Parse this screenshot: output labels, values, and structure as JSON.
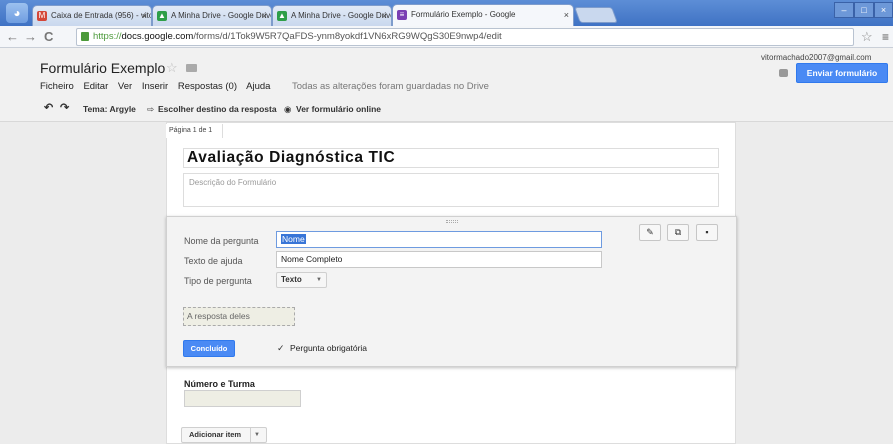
{
  "browser": {
    "tabs": [
      {
        "label": "Caixa de Entrada (956) - vito",
        "icon": "gmail-icon",
        "icon_color": "#d44638"
      },
      {
        "label": "A Minha Drive - Google Drive",
        "icon": "drive-icon",
        "icon_color": "#2e9e48"
      },
      {
        "label": "A Minha Drive - Google Drive",
        "icon": "drive-icon",
        "icon_color": "#2e9e48"
      },
      {
        "label": "Formulário Exemplo - Google",
        "icon": "forms-icon",
        "icon_color": "#7a3fb3"
      }
    ],
    "url_scheme": "https://",
    "url_host": "docs.google.com",
    "url_path": "/forms/d/1Tok9W5R7QaFDS-ynm8yokdf1VN6xRG9WQgS30E9nwp4/edit"
  },
  "header": {
    "doc_title": "Formulário Exemplo",
    "menu": [
      "Ficheiro",
      "Editar",
      "Ver",
      "Inserir",
      "Respostas (0)",
      "Ajuda"
    ],
    "saved_status": "Todas as alterações foram guardadas no Drive",
    "user_email": "vitormachado2007@gmail.com",
    "send_label": "Enviar formulário"
  },
  "toolbar": {
    "theme": "Tema: Argyle",
    "destination": "Escolher destino da resposta",
    "view_online": "Ver formulário online"
  },
  "form": {
    "page_indicator": "Página 1 de 1",
    "title": "Avaliação Diagnóstica TIC",
    "description_placeholder": "Descrição do Formulário"
  },
  "question_editor": {
    "name_label": "Nome da pergunta",
    "name_value": "Nome",
    "help_label": "Texto de ajuda",
    "help_value": "Nome Completo",
    "type_label": "Tipo de pergunta",
    "type_value": "Texto",
    "answer_preview": "A resposta deles",
    "done_label": "Concluído",
    "required_label": "Pergunta obrigatória",
    "required_checked": true
  },
  "next_question": {
    "title": "Número e Turma"
  },
  "add_item_label": "Adicionar item",
  "accent_color": "#4a8af4"
}
